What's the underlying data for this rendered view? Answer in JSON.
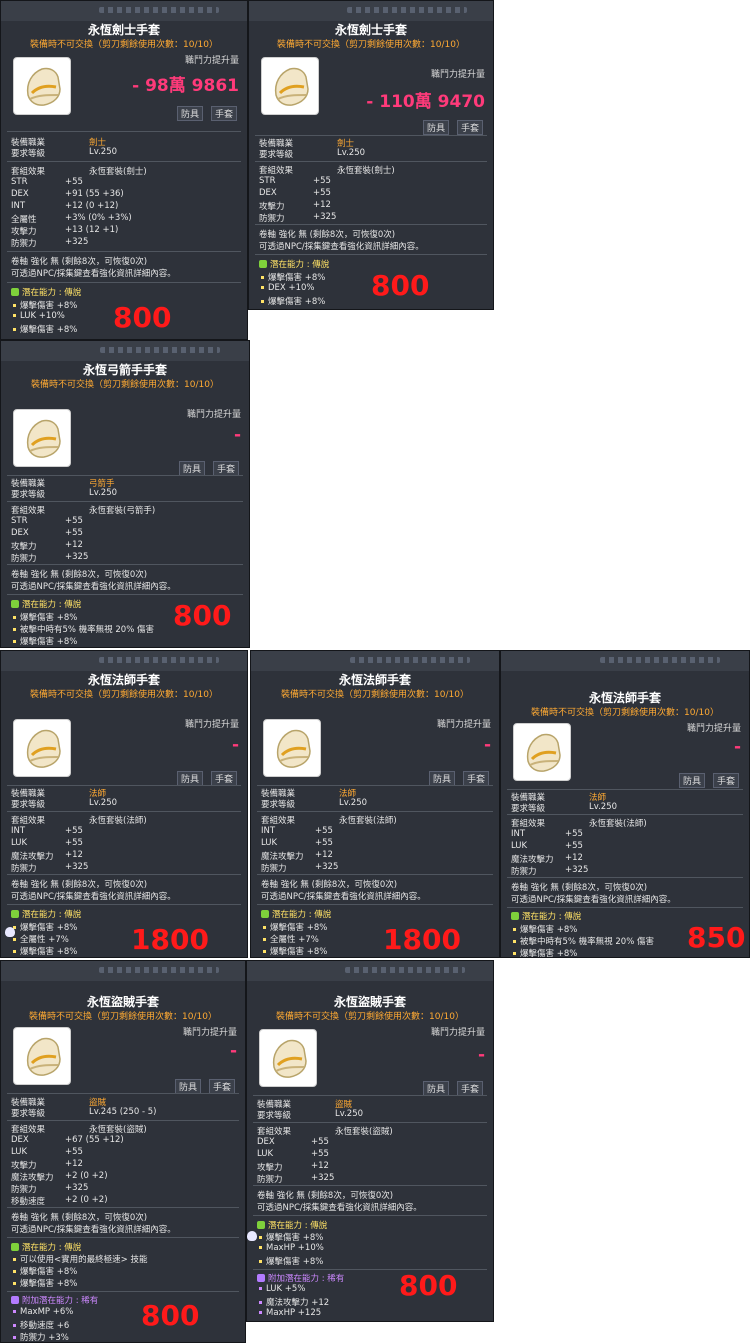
{
  "colors": {
    "panel": "#2e323a",
    "gold": "#ffaa33",
    "power": "#ff3a7a",
    "price": "#ff1a1a",
    "green": "#55ee55"
  },
  "icons": {
    "item": "glove-icon",
    "potential_badge": "potential-badge-icon"
  },
  "cards": [
    {
      "title": "永恆劍士手套",
      "sub": "裝備時不可交換（剪刀剩餘使用次數：10/10）",
      "power_label": "職鬥力提升量",
      "power_value": "- 98萬 9861",
      "tag1": "防具",
      "tag2": "手套",
      "job_label": "裝備職業",
      "job": "劍士",
      "level_label": "要求等級",
      "level": "Lv.250",
      "set_label": "套組效果",
      "set": "永恆套裝(劍士)",
      "stats": [
        {
          "k": "STR",
          "v": "+55"
        },
        {
          "k": "DEX",
          "v": "+91 (55 +36)"
        },
        {
          "k": "INT",
          "v": "+12 (0 +12)"
        },
        {
          "k": "全屬性",
          "v": "+3% (0% +3%)"
        },
        {
          "k": "攻擊力",
          "v": "+13 (12 +1)"
        },
        {
          "k": "防禦力",
          "v": "+325"
        }
      ],
      "scroll": "卷軸 強化 無 (剩餘8次，可恢復0次)",
      "npc": "可透過NPC/採集鍵查看強化資訊詳細內容。",
      "potential_label": "潛在能力 : 傳說",
      "potentials": [
        "爆擊傷害 +8%",
        "LUK +10%",
        "爆擊傷害 +8%"
      ],
      "price": "800"
    },
    {
      "title": "永恆劍士手套",
      "sub": "裝備時不可交換（剪刀剩餘使用次數：10/10）",
      "power_label": "職鬥力提升量",
      "power_value": "- 110萬 9470",
      "tag1": "防具",
      "tag2": "手套",
      "job_label": "裝備職業",
      "job": "劍士",
      "level_label": "要求等級",
      "level": "Lv.250",
      "set_label": "套組效果",
      "set": "永恆套裝(劍士)",
      "stats": [
        {
          "k": "STR",
          "v": "+55"
        },
        {
          "k": "DEX",
          "v": "+55"
        },
        {
          "k": "攻擊力",
          "v": "+12"
        },
        {
          "k": "防禦力",
          "v": "+325"
        }
      ],
      "scroll": "卷軸 強化 無 (剩餘8次，可恢復0次)",
      "npc": "可透過NPC/採集鍵查看強化資訊詳細內容。",
      "potential_label": "潛在能力 : 傳說",
      "potentials": [
        "爆擊傷害 +8%",
        "DEX +10%",
        "爆擊傷害 +8%"
      ],
      "price": "800"
    },
    {
      "title": "永恆弓箭手手套",
      "sub": "裝備時不可交換（剪刀剩餘使用次數：10/10）",
      "power_label": "職鬥力提升量",
      "power_value": "-",
      "tag1": "防具",
      "tag2": "手套",
      "job_label": "裝備職業",
      "job": "弓箭手",
      "level_label": "要求等級",
      "level": "Lv.250",
      "set_label": "套組效果",
      "set": "永恆套裝(弓箭手)",
      "stats": [
        {
          "k": "STR",
          "v": "+55"
        },
        {
          "k": "DEX",
          "v": "+55"
        },
        {
          "k": "攻擊力",
          "v": "+12"
        },
        {
          "k": "防禦力",
          "v": "+325"
        }
      ],
      "scroll": "卷軸 強化 無 (剩餘8次，可恢復0次)",
      "npc": "可透過NPC/採集鍵查看強化資訊詳細內容。",
      "potential_label": "潛在能力 : 傳說",
      "potentials": [
        "爆擊傷害 +8%",
        "被擊中時有5% 機率無視 20% 傷害",
        "爆擊傷害 +8%"
      ],
      "price": "800"
    },
    {
      "title": "永恆法師手套",
      "sub": "裝備時不可交換（剪刀剩餘使用次數：10/10）",
      "power_label": "職鬥力提升量",
      "power_value": "-",
      "tag1": "防具",
      "tag2": "手套",
      "job_label": "裝備職業",
      "job": "法師",
      "level_label": "要求等級",
      "level": "Lv.250",
      "set_label": "套組效果",
      "set": "永恆套裝(法師)",
      "stats": [
        {
          "k": "INT",
          "v": "+55"
        },
        {
          "k": "LUK",
          "v": "+55"
        },
        {
          "k": "魔法攻擊力",
          "v": "+12"
        },
        {
          "k": "防禦力",
          "v": "+325"
        }
      ],
      "scroll": "卷軸 強化 無 (剩餘8次，可恢復0次)",
      "npc": "可透過NPC/採集鍵查看強化資訊詳細內容。",
      "potential_label": "潛在能力 : 傳說",
      "potentials": [
        "爆擊傷害 +8%",
        "全屬性 +7%",
        "爆擊傷害 +8%"
      ],
      "price": "1800"
    },
    {
      "title": "永恆法師手套",
      "sub": "裝備時不可交換（剪刀剩餘使用次數：10/10）",
      "power_label": "職鬥力提升量",
      "power_value": "-",
      "tag1": "防具",
      "tag2": "手套",
      "job_label": "裝備職業",
      "job": "法師",
      "level_label": "要求等級",
      "level": "Lv.250",
      "set_label": "套組效果",
      "set": "永恆套裝(法師)",
      "stats": [
        {
          "k": "INT",
          "v": "+55"
        },
        {
          "k": "LUK",
          "v": "+55"
        },
        {
          "k": "魔法攻擊力",
          "v": "+12"
        },
        {
          "k": "防禦力",
          "v": "+325"
        }
      ],
      "scroll": "卷軸 強化 無 (剩餘8次，可恢復0次)",
      "npc": "可透過NPC/採集鍵查看強化資訊詳細內容。",
      "potential_label": "潛在能力 : 傳說",
      "potentials": [
        "爆擊傷害 +8%",
        "全屬性 +7%",
        "爆擊傷害 +8%"
      ],
      "price": "1800"
    },
    {
      "title": "永恆法師手套",
      "sub": "裝備時不可交換（剪刀剩餘使用次數：10/10）",
      "power_label": "職鬥力提升量",
      "power_value": "-",
      "tag1": "防具",
      "tag2": "手套",
      "job_label": "裝備職業",
      "job": "法師",
      "level_label": "要求等級",
      "level": "Lv.250",
      "set_label": "套組效果",
      "set": "永恆套裝(法師)",
      "stats": [
        {
          "k": "INT",
          "v": "+55"
        },
        {
          "k": "LUK",
          "v": "+55"
        },
        {
          "k": "魔法攻擊力",
          "v": "+12"
        },
        {
          "k": "防禦力",
          "v": "+325"
        }
      ],
      "scroll": "卷軸 強化 無 (剩餘8次，可恢復0次)",
      "npc": "可透過NPC/採集鍵查看強化資訊詳細內容。",
      "potential_label": "潛在能力 : 傳說",
      "potentials": [
        "爆擊傷害 +8%",
        "被擊中時有5% 機率無視 20% 傷害",
        "爆擊傷害 +8%"
      ],
      "price": "850"
    },
    {
      "title": "永恆盜賊手套",
      "sub": "裝備時不可交換（剪刀剩餘使用次數：10/10）",
      "power_label": "職鬥力提升量",
      "power_value": "-",
      "tag1": "防具",
      "tag2": "手套",
      "job_label": "裝備職業",
      "job": "盜賊",
      "level_label": "要求等級",
      "level": "Lv.245 (250 - 5)",
      "set_label": "套組效果",
      "set": "永恆套裝(盜賊)",
      "stats": [
        {
          "k": "DEX",
          "v": "+67 (55 +12)"
        },
        {
          "k": "LUK",
          "v": "+55"
        },
        {
          "k": "攻擊力",
          "v": "+12"
        },
        {
          "k": "魔法攻擊力",
          "v": "+2 (0 +2)"
        },
        {
          "k": "防禦力",
          "v": "+325"
        },
        {
          "k": "移動速度",
          "v": "+2 (0 +2)"
        }
      ],
      "scroll": "卷軸 強化 無 (剩餘8次，可恢復0次)",
      "npc": "可透過NPC/採集鍵查看強化資訊詳細內容。",
      "potential_label": "潛在能力 : 傳說",
      "potentials": [
        "可以使用<實用的最終極速> 技能",
        "爆擊傷害 +8%",
        "爆擊傷害 +8%"
      ],
      "bonus_label": "附加潛在能力 : 稀有",
      "bonus": [
        "MaxMP +6%",
        "移動速度 +6",
        "防禦力 +3%"
      ],
      "price": "800"
    },
    {
      "title": "永恆盜賊手套",
      "sub": "裝備時不可交換（剪刀剩餘使用次數：10/10）",
      "power_label": "職鬥力提升量",
      "power_value": "-",
      "tag1": "防具",
      "tag2": "手套",
      "job_label": "裝備職業",
      "job": "盜賊",
      "level_label": "要求等級",
      "level": "Lv.250",
      "set_label": "套組效果",
      "set": "永恆套裝(盜賊)",
      "stats": [
        {
          "k": "DEX",
          "v": "+55"
        },
        {
          "k": "LUK",
          "v": "+55"
        },
        {
          "k": "攻擊力",
          "v": "+12"
        },
        {
          "k": "防禦力",
          "v": "+325"
        }
      ],
      "scroll": "卷軸 強化 無 (剩餘8次，可恢復0次)",
      "npc": "可透過NPC/採集鍵查看強化資訊詳細內容。",
      "potential_label": "潛在能力 : 傳說",
      "potentials": [
        "爆擊傷害 +8%",
        "MaxHP +10%",
        "爆擊傷害 +8%"
      ],
      "bonus_label": "附加潛在能力 : 稀有",
      "bonus": [
        "LUK +5%",
        "魔法攻擊力 +12",
        "MaxHP +125"
      ],
      "price": "800"
    }
  ]
}
